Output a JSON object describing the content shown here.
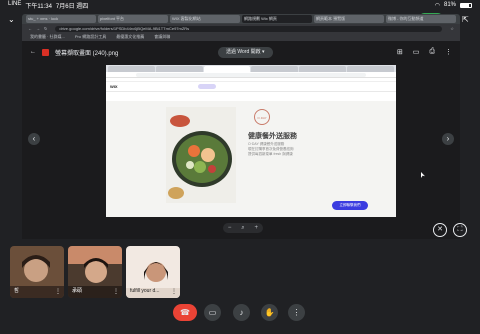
{
  "status_bar": {
    "left_text": "LINE",
    "time": "下午11:34",
    "date": "7月6日 週四",
    "battery_pct": "81%"
  },
  "browser": {
    "tabs": [
      "stu_ + xms · lock",
      "pixelfont 平台",
      "WIX 客製化網站",
      "網路規劃 Wix 網頁",
      "網頁範本 預覽版",
      "微博 - 你的互動頻道"
    ],
    "url": "drive.google.com/drive/folders/1PSDb44rc6jBQeMA-9Bi1TTmCe97mZRs",
    "bookmarks": [
      "我的書籤 · 社群媒...",
      "Pro 網路設計工具",
      "最優惠文化推薦",
      "會議與聯"
    ]
  },
  "viewer": {
    "file_name": "螢幕擷取畫面 (240).png",
    "open_with": "透過 Word 開啟",
    "zoom_minus": "−",
    "zoom_plus": "+"
  },
  "screenshot": {
    "wix_label": "WIX",
    "brand_logo": "O·DAY",
    "brand_title": "健康餐外送服務",
    "brand_lines": [
      "O·DAY 健康餐外送服務",
      "現在訂購享首次免費營養諮詢",
      "提供每週新菜單 fresh 與健康"
    ],
    "chat_button": "立即聯繫我們"
  },
  "participants": [
    {
      "name": "哲",
      "bg": "#6b4f3a"
    },
    {
      "name": "承碩",
      "bg": "#4b3a2e"
    },
    {
      "name": "fulfill your d...",
      "bg": "#f2e9e2"
    }
  ],
  "colors": {
    "end_call": "#ea4335",
    "accent": "#3b3ce0"
  }
}
